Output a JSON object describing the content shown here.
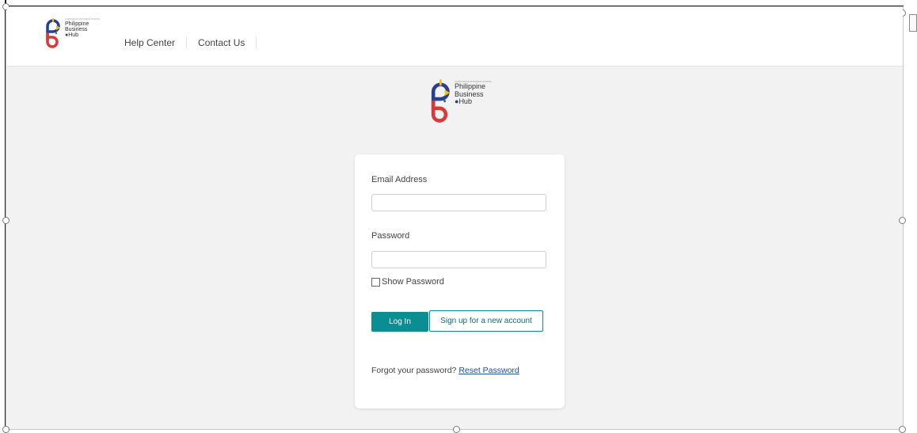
{
  "brand": {
    "small_caption": "CORPORATE BUSINESS PORTAL",
    "line1": "Philippine",
    "line2": "Business",
    "line3": "Hub"
  },
  "nav": {
    "help_center": "Help Center",
    "contact_us": "Contact Us"
  },
  "login": {
    "email_label": "Email Address",
    "email_value": "",
    "password_label": "Password",
    "password_value": "",
    "show_password_label": "Show Password",
    "login_button": "Log In",
    "signup_button": "Sign up for a new account",
    "forgot_prefix": "Forgot your password?",
    "reset_link": "Reset Password"
  },
  "colors": {
    "accent": "#0a8d93",
    "link": "#1f4fa3",
    "logo_blue": "#2a3f8f",
    "logo_red": "#d83a3a",
    "logo_yellow": "#f2c21b"
  }
}
